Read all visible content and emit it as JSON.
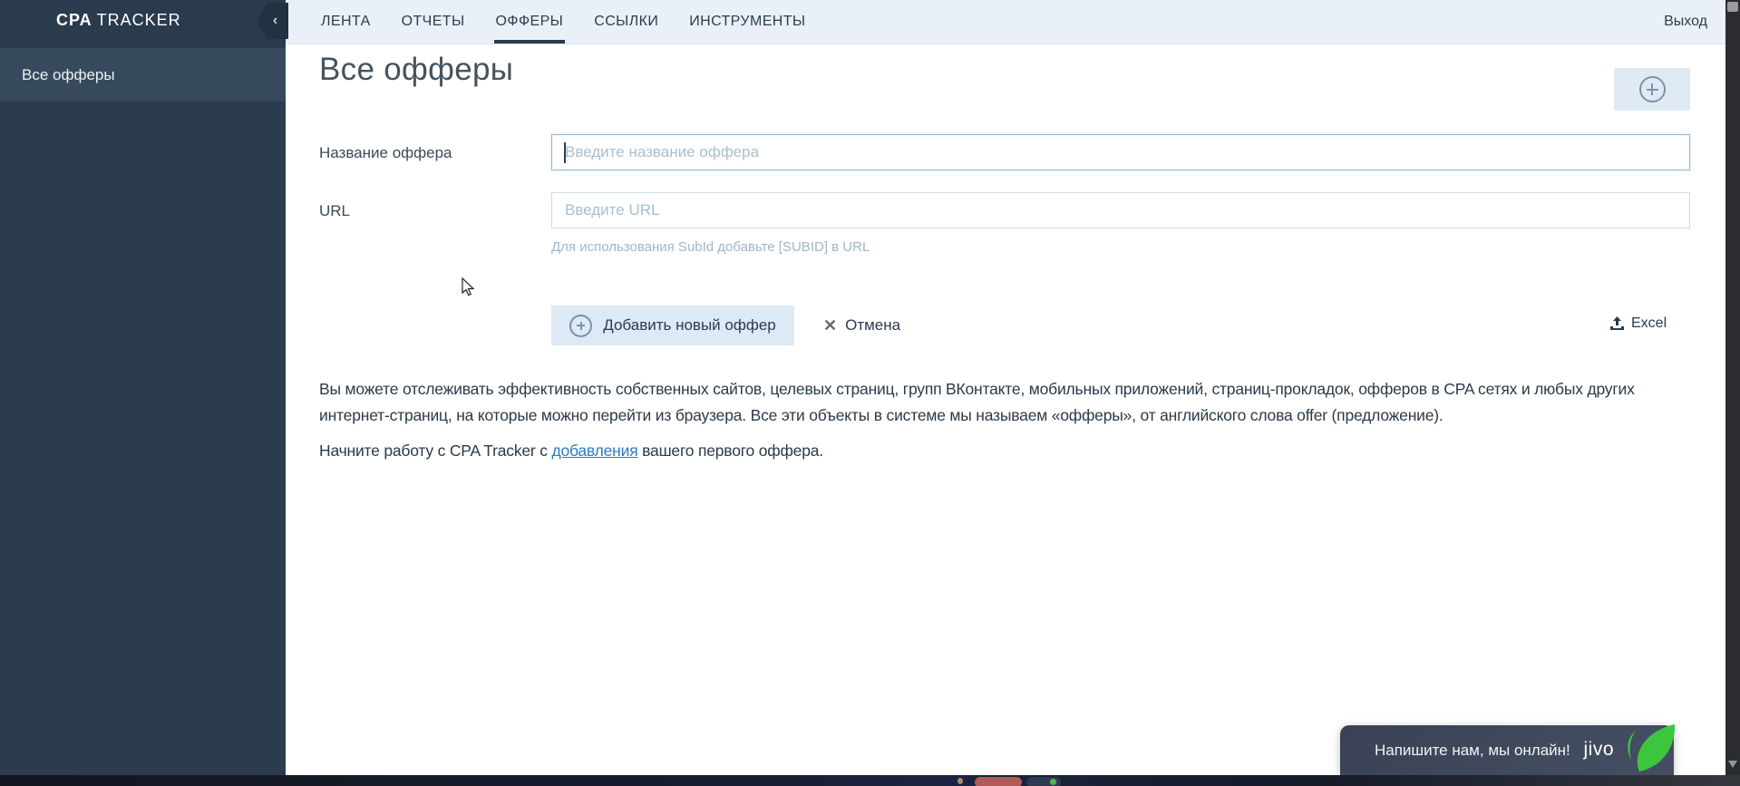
{
  "header": {
    "logo": {
      "bold": "CPA",
      "rest": "TRACKER"
    },
    "collapse_icon": "‹",
    "tabs": [
      {
        "label": "ЛЕНТА",
        "active": false
      },
      {
        "label": "ОТЧЕТЫ",
        "active": false
      },
      {
        "label": "ОФФЕРЫ",
        "active": true
      },
      {
        "label": "ССЫЛКИ",
        "active": false
      },
      {
        "label": "ИНСТРУМЕНТЫ",
        "active": false
      }
    ],
    "logout_label": "Выход"
  },
  "sidebar": {
    "items": [
      {
        "label": "Все офферы",
        "selected": true
      }
    ]
  },
  "main": {
    "title": "Все офферы",
    "form": {
      "fields": [
        {
          "label": "Название оффера",
          "placeholder": "Введите название оффера",
          "value": "",
          "focused": true
        },
        {
          "label": "URL",
          "placeholder": "Введите URL",
          "value": "",
          "focused": false
        }
      ],
      "url_hint": "Для использования SubId добавьте [SUBID] в URL",
      "submit_label": "Добавить новый оффер",
      "cancel_label": "Отмена",
      "cancel_icon": "✕",
      "excel_label": "Excel"
    },
    "intro_paragraph": "Вы можете отслеживать эффективность собственных сайтов, целевых страниц, групп ВКонтакте, мобильных приложений, страниц-прокладок, офферов в CPA сетях и любых других интернет-страниц, на которые можно перейти из браузера. Все эти объекты в системе мы называем «офферы», от английского слова offer (предложение).",
    "start_paragraph": {
      "before": "Начните работу с CPA Tracker с ",
      "link": "добавления",
      "after": " вашего первого оффера."
    }
  },
  "chat_widget": {
    "message": "Напишите нам, мы онлайн!",
    "brand": "jivo"
  },
  "colors": {
    "brand_dark": "#2a3b4d",
    "sidebar_bg": "#2b3c4e",
    "sidebar_selected": "#37495c",
    "nav_bg": "#e9f0f7",
    "button_bg": "#dde9f5",
    "link_blue": "#2a7cc7",
    "placeholder": "#a8bed2",
    "hint_text": "#9fb6cb",
    "jivo_green": "#3ec53e"
  }
}
